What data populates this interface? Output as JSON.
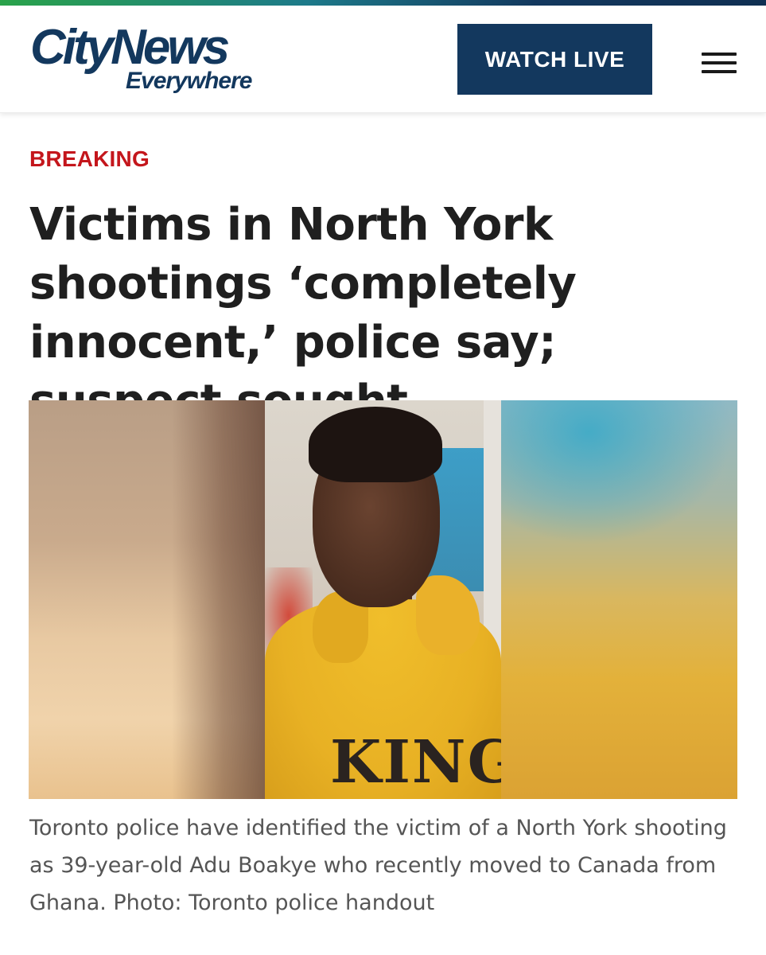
{
  "header": {
    "logo": {
      "main": "CityNews",
      "sub": "Everywhere"
    },
    "watch_live_label": "WATCH LIVE",
    "menu_icon": "hamburger-menu-icon"
  },
  "article": {
    "kicker": "BREAKING",
    "headline": "Victims in North York shootings ‘completely innocent,’ police say; suspect sought",
    "image": {
      "printed_text": "KING"
    },
    "caption": "Toronto police have identified the victim of a North York shooting as 39-year-old Adu Boakye who recently moved to Canada from Ghana. Photo: Toronto police handout"
  },
  "colors": {
    "brand_navy": "#13385e",
    "breaking_red": "#c4161c",
    "headline_text": "#1f1f1f",
    "caption_text": "#555555"
  }
}
